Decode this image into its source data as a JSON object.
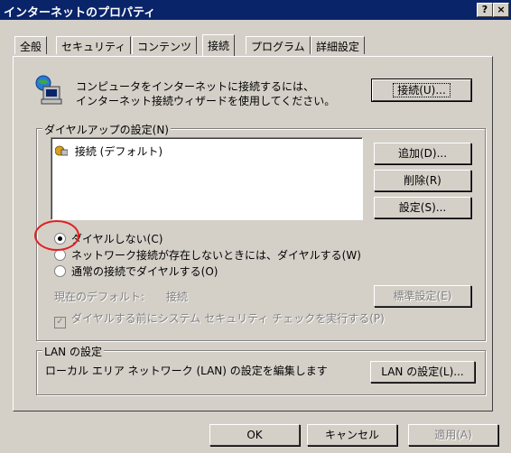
{
  "window": {
    "title": "インターネットのプロパティ",
    "help_btn": "?",
    "close_btn": "×"
  },
  "tabs": [
    {
      "label": "全般"
    },
    {
      "label": "セキュリティ"
    },
    {
      "label": "コンテンツ"
    },
    {
      "label": "接続"
    },
    {
      "label": "プログラム"
    },
    {
      "label": "詳細設定"
    }
  ],
  "active_tab": "接続",
  "connect": {
    "text_line1": "コンピュータをインターネットに接続するには、",
    "text_line2": "インターネット接続ウィザードを使用してください。",
    "button": "接続(U)..."
  },
  "dialup": {
    "group_label": "ダイヤルアップの設定(N)",
    "list_items": [
      "接続 (デフォルト)"
    ],
    "add_button": "追加(D)...",
    "remove_button": "削除(R)",
    "settings_button": "設定(S)...",
    "radio_options": [
      {
        "label": "ダイヤルしない(C)",
        "selected": true
      },
      {
        "label": "ネットワーク接続が存在しないときには、ダイヤルする(W)",
        "selected": false
      },
      {
        "label": "通常の接続でダイヤルする(O)",
        "selected": false
      }
    ],
    "current_default_label": "現在のデフォルト:",
    "current_default_value": "接続",
    "set_default_button": "標準設定(E)",
    "security_check_label": "ダイヤルする前にシステム セキュリティ チェックを実行する(P)",
    "security_check_checked": true
  },
  "lan": {
    "group_label": "LAN の設定",
    "text": "ローカル エリア ネットワーク (LAN) の設定を編集します",
    "button": "LAN の設定(L)..."
  },
  "footer": {
    "ok": "OK",
    "cancel": "キャンセル",
    "apply": "適用(A)"
  },
  "colors": {
    "titlebar": "#0a246a",
    "face": "#d4d0c8",
    "highlight_circle": "#e02020"
  }
}
